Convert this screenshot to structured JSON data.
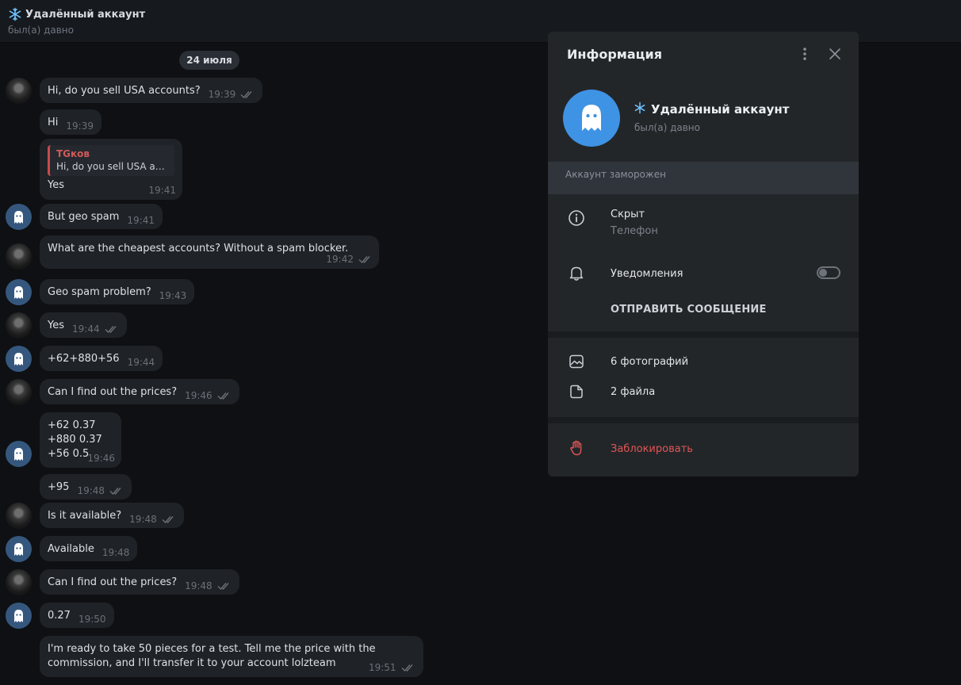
{
  "header": {
    "title": "Удалённый аккаунт",
    "status": "был(а) давно",
    "title_icon": "snowflake-icon"
  },
  "date_separator": "24 июля",
  "messages": [
    {
      "text": "Hi, do you sell USA accounts?",
      "time": "19:39",
      "read": true,
      "avatar": "photo"
    },
    {
      "text": "Hi",
      "time": "19:39",
      "read": false,
      "avatar": "none"
    },
    {
      "reply_name": "TGков",
      "reply_text": "Hi, do you sell USA acc...",
      "text": "Yes",
      "time": "19:41",
      "read": false,
      "avatar": "none"
    },
    {
      "text": "But geo spam",
      "time": "19:41",
      "read": false,
      "avatar": "ghost"
    },
    {
      "text": "What are the cheapest accounts? Without a spam blocker.",
      "time": "19:42",
      "read": true,
      "avatar": "photo"
    },
    {
      "text": "Geo spam problem?",
      "time": "19:43",
      "read": false,
      "avatar": "ghost"
    },
    {
      "text": "Yes",
      "time": "19:44",
      "read": true,
      "avatar": "photo"
    },
    {
      "text": "+62+880+56",
      "time": "19:44",
      "read": false,
      "avatar": "ghost"
    },
    {
      "text": "Can I find out the prices?",
      "time": "19:46",
      "read": true,
      "avatar": "photo"
    },
    {
      "lines": [
        "+62 0.37",
        "+880 0.37",
        "+56 0.5"
      ],
      "time": "19:46",
      "read": false,
      "avatar": "ghost"
    },
    {
      "text": "+95",
      "time": "19:48",
      "read": true,
      "avatar": "none"
    },
    {
      "text": "Is it available?",
      "time": "19:48",
      "read": true,
      "avatar": "photo"
    },
    {
      "text": "Available",
      "time": "19:48",
      "read": false,
      "avatar": "ghost"
    },
    {
      "text": "Can I find out the prices?",
      "time": "19:48",
      "read": true,
      "avatar": "photo"
    },
    {
      "text": "0.27",
      "time": "19:50",
      "read": false,
      "avatar": "ghost"
    },
    {
      "lines": [
        "I'm ready to take 50 pieces for a test. Tell me the price with the",
        "commission, and I'll transfer it to your account lolzteam"
      ],
      "time": "19:51",
      "read": true,
      "avatar": "none"
    }
  ],
  "panel": {
    "title": "Информация",
    "name": "Удалённый аккаунт",
    "status": "был(а) давно",
    "frozen_label": "Аккаунт заморожен",
    "phone_value": "Скрыт",
    "phone_label": "Телефон",
    "notifications_label": "Уведомления",
    "notifications_on": false,
    "send_message": "ОТПРАВИТЬ СООБЩЕНИЕ",
    "photos": "6 фотографий",
    "files": "2 файла",
    "block": "Заблокировать"
  },
  "colors": {
    "accent_blue": "#3f93e4",
    "danger": "#e05555",
    "bubble": "#1f2227",
    "panel": "#232629"
  }
}
